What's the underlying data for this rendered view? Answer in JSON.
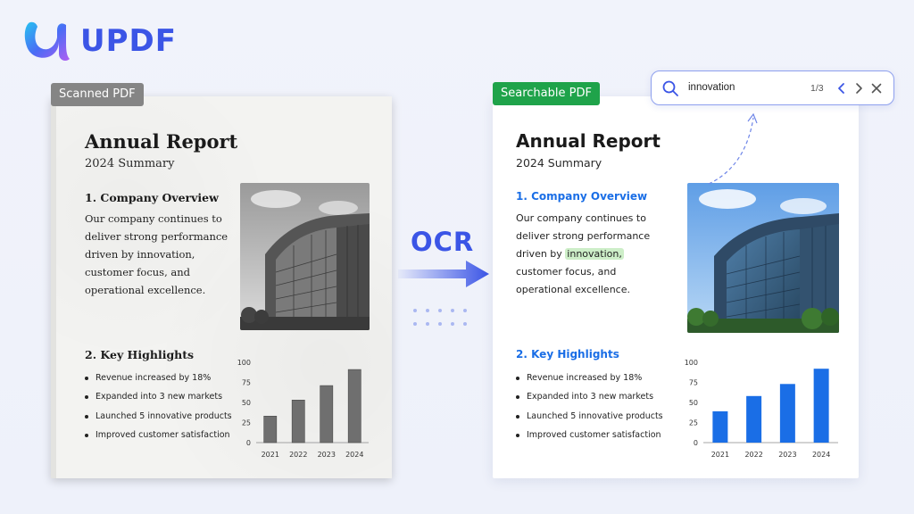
{
  "logo": {
    "text": "UPDF",
    "icon": "updf-logo-icon"
  },
  "scanned": {
    "tag": "Scanned PDF",
    "title": "Annual Report",
    "subtitle": "2024 Summary",
    "section1_title": "1. Company Overview",
    "body_lines": [
      "Our company continues to",
      "deliver strong performance",
      "driven by innovation,",
      "customer focus, and",
      "operational excellence."
    ],
    "section2_title": "2. Key Highlights",
    "bullets": [
      "Revenue increased by 18%",
      "Expanded into 3 new markets",
      "Launched 5 innovative products",
      "Improved customer satisfaction"
    ]
  },
  "searchable": {
    "tag": "Searchable PDF",
    "title": "Annual Report",
    "subtitle": "2024 Summary",
    "section1_title": "1. Company Overview",
    "body_lines": [
      "Our company continues to",
      "deliver strong performance",
      "customer focus, and",
      "operational excellence."
    ],
    "body_line3_prefix": "driven by ",
    "body_line3_highlight": "innovation,",
    "section2_title": "2. Key Highlights",
    "bullets": [
      "Revenue increased by 18%",
      "Expanded into 3 new markets",
      "Launched 5 innovative products",
      "Improved customer satisfaction"
    ]
  },
  "ocr": {
    "label": "OCR"
  },
  "search": {
    "query": "innovation",
    "count": "1/3",
    "icons": [
      "search-icon",
      "chevron-left-icon",
      "chevron-right-icon",
      "close-icon"
    ]
  },
  "colors": {
    "brand": "#3b55e6",
    "accent_blue": "#1a6ee6",
    "highlight": "#cdeec8",
    "green_tag": "#1fa34a",
    "gray_tag": "#858585",
    "scanned_bar": "#6f6f6f"
  },
  "chart_data": [
    {
      "type": "bar",
      "categories": [
        "2021",
        "2022",
        "2023",
        "2024"
      ],
      "values": [
        33,
        53,
        71,
        91
      ],
      "ylim": [
        0,
        100
      ],
      "yticks": [
        "0",
        "25",
        "50",
        "75",
        "100"
      ],
      "color": "#6f6f6f"
    },
    {
      "type": "bar",
      "categories": [
        "2021",
        "2022",
        "2023",
        "2024"
      ],
      "values": [
        39,
        58,
        73,
        92
      ],
      "ylim": [
        0,
        100
      ],
      "yticks": [
        "0",
        "25",
        "50",
        "75",
        "100"
      ],
      "color": "#1a6ee6"
    }
  ]
}
